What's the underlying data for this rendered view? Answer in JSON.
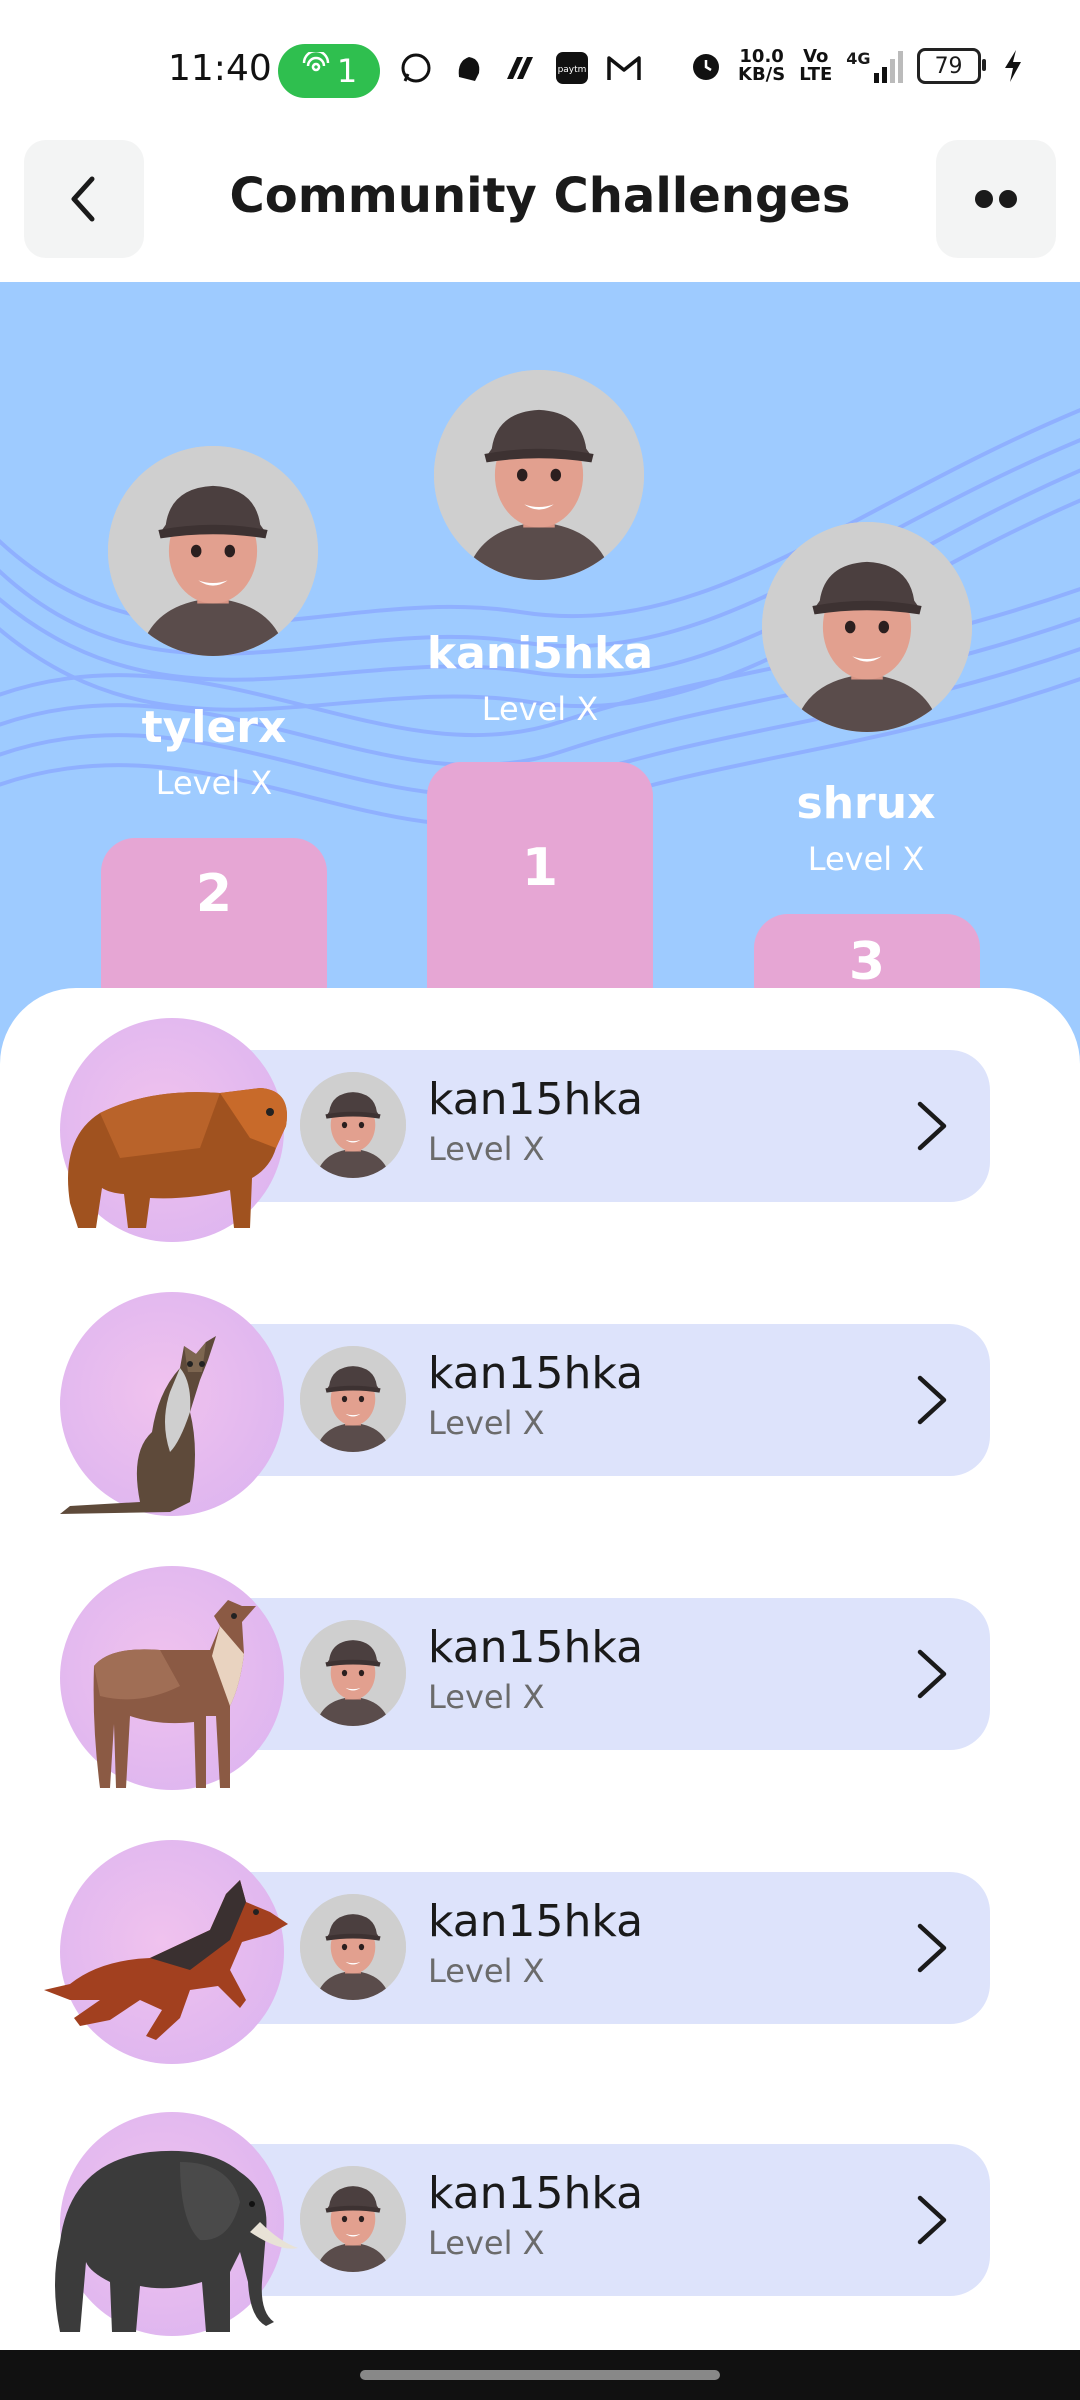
{
  "status_bar": {
    "time": "11:40",
    "hotspot_count": "1",
    "net_speed": "10.0\nKB/S",
    "net_type": "4G",
    "volte": "Vo\nLTE",
    "battery": "79",
    "icons": [
      "hotspot-icon",
      "whatsapp-icon",
      "notification-icon",
      "app-icon",
      "paytm-icon",
      "gmail-icon",
      "alarm-icon",
      "signal-icon",
      "battery-icon",
      "charging-icon"
    ]
  },
  "header": {
    "title": "Community Challenges",
    "back_icon": "chevron-left-icon",
    "more_icon": "more-dots-icon"
  },
  "podium": [
    {
      "rank": "2",
      "name": "tylerx",
      "level": "Level X"
    },
    {
      "rank": "1",
      "name": "kani5hka",
      "level": "Level X"
    },
    {
      "rank": "3",
      "name": "shrux",
      "level": "Level X"
    }
  ],
  "list": [
    {
      "animal": "bear",
      "name": "kan15hka",
      "level": "Level X"
    },
    {
      "animal": "cat",
      "name": "kan15hka",
      "level": "Level X"
    },
    {
      "animal": "deer",
      "name": "kan15hka",
      "level": "Level X"
    },
    {
      "animal": "dog",
      "name": "kan15hka",
      "level": "Level X"
    },
    {
      "animal": "elephant",
      "name": "kan15hka",
      "level": "Level X"
    }
  ],
  "colors": {
    "podium_bg": "#9ecbff",
    "podium_block": "#e6a6d4",
    "card_bg": "#dde3fb",
    "hotspot_green": "#2fbf4f"
  }
}
